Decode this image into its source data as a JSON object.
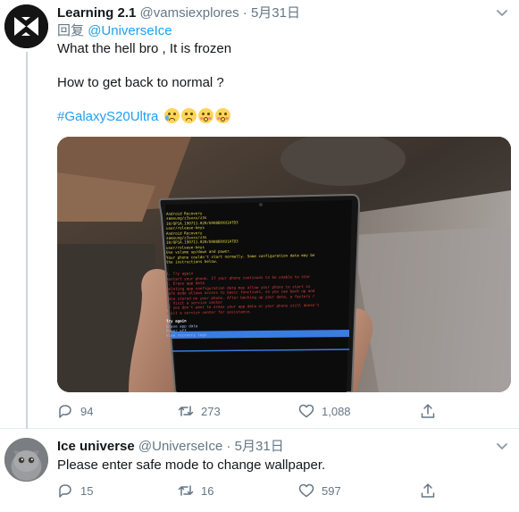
{
  "tweets": [
    {
      "display_name": "Learning 2.1",
      "handle": "@vamsiexplores",
      "dot": "·",
      "date": "5月31日",
      "reply_prefix": "回复",
      "reply_to": "@UniverseIce",
      "lines": [
        "What the hell bro , It is frozen",
        "How to get back to normal ?"
      ],
      "hashtag": "#GalaxyS20Ultra",
      "emojis": [
        "crying-face-emoji",
        "worried-face-emoji",
        "flushed-face-emoji",
        "flushed-face-emoji"
      ],
      "media": {
        "screen_lines_top": [
          "Android Recovery",
          "samsung/z3sxxx/z3s",
          "10/QP1A.190711.020/G988BXXU1ATD3",
          "user/release-keys",
          "Android Recovery",
          "samsung/z3sxxx/z3s",
          "10/QP1A.190711.020/G988BXXU1ATD3",
          "user/release-keys",
          "Use volume up/down and power.",
          "Your phone couldn't start normally. Some configuration data may be",
          "the instructions below."
        ],
        "screen_lines_bottom": [
          "1. Try again",
          "Restart your phone. If your phone continues to be unable to star",
          "2. Erase app data",
          "Deleting app configuration data may allow your phone to start in",
          "Safe mode allows access to basic functions, so you can back up and",
          "data stored on your phone. After backing up your data, a factory r",
          "3. Visit a service center",
          "If you don't want to erase your app data or your phone still doesn't",
          "visit a service center for assistance."
        ],
        "selected_option": "Try again",
        "other_options": [
          "Erase app data",
          "Power off",
          "View recovery logs"
        ]
      },
      "actions": {
        "reply": "94",
        "retweet": "273",
        "like": "1,088"
      }
    },
    {
      "display_name": "Ice universe",
      "handle": "@UniverseIce",
      "dot": "·",
      "date": "5月31日",
      "lines": [
        "Please enter safe mode to change wallpaper."
      ],
      "actions": {
        "reply": "15",
        "retweet": "16",
        "like": "597"
      }
    }
  ],
  "icons": {
    "more": "chevron-down-icon",
    "reply": "reply-icon",
    "retweet": "retweet-icon",
    "like": "heart-icon",
    "share": "share-icon"
  },
  "colors": {
    "link": "#1da1f2",
    "secondary": "#657786",
    "text": "#14171a",
    "recovery_red": "#e23b3b",
    "recovery_yellow": "#e8d84a",
    "recovery_highlight": "#3a7de0"
  }
}
